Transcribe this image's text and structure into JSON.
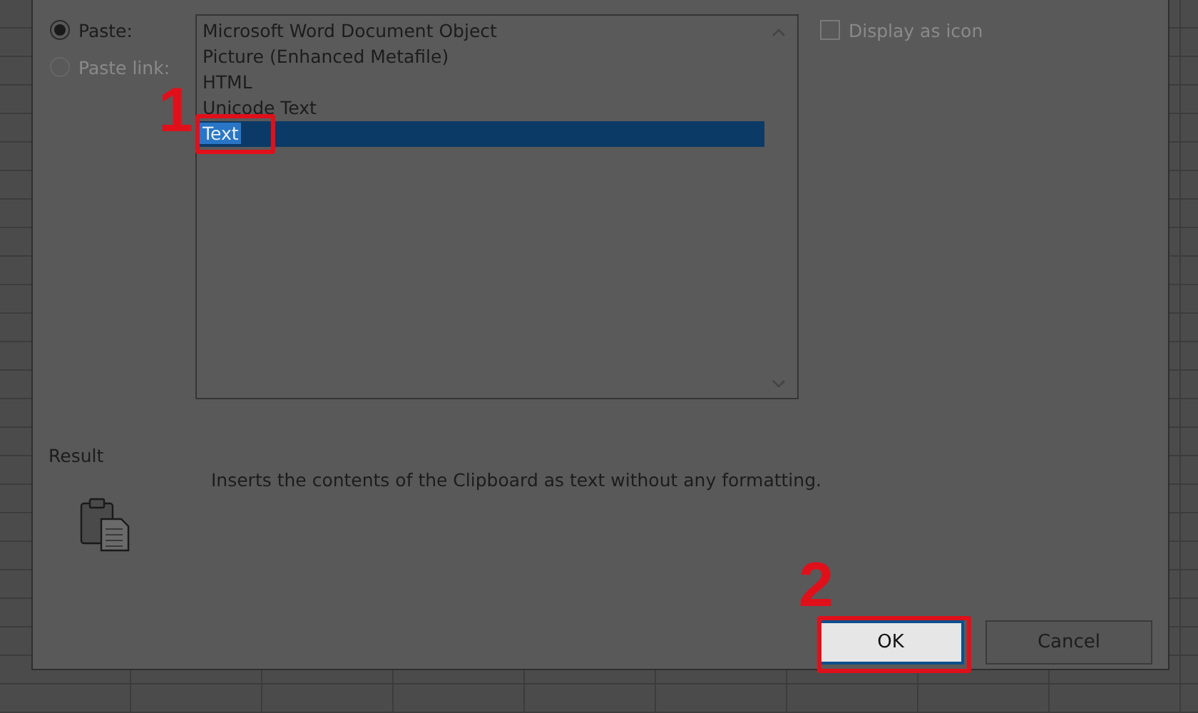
{
  "paste_options": [
    {
      "label": "Paste:",
      "selected": true,
      "disabled": false
    },
    {
      "label": "Paste link:",
      "selected": false,
      "disabled": true
    }
  ],
  "as_list": {
    "items": [
      {
        "label": "Microsoft Word Document Object",
        "selected": false
      },
      {
        "label": "Picture (Enhanced Metafile)",
        "selected": false
      },
      {
        "label": "HTML",
        "selected": false
      },
      {
        "label": "Unicode Text",
        "selected": false
      },
      {
        "label": "Text",
        "selected": true
      }
    ]
  },
  "display_as_icon": {
    "label": "Display as icon",
    "checked": false,
    "disabled": true
  },
  "result": {
    "title": "Result",
    "description": "Inserts the contents of the Clipboard as text without any formatting."
  },
  "buttons": [
    {
      "label": "OK",
      "kind": "default"
    },
    {
      "label": "Cancel",
      "kind": "normal"
    }
  ],
  "annotations": [
    {
      "label": "1"
    },
    {
      "label": "2"
    }
  ]
}
